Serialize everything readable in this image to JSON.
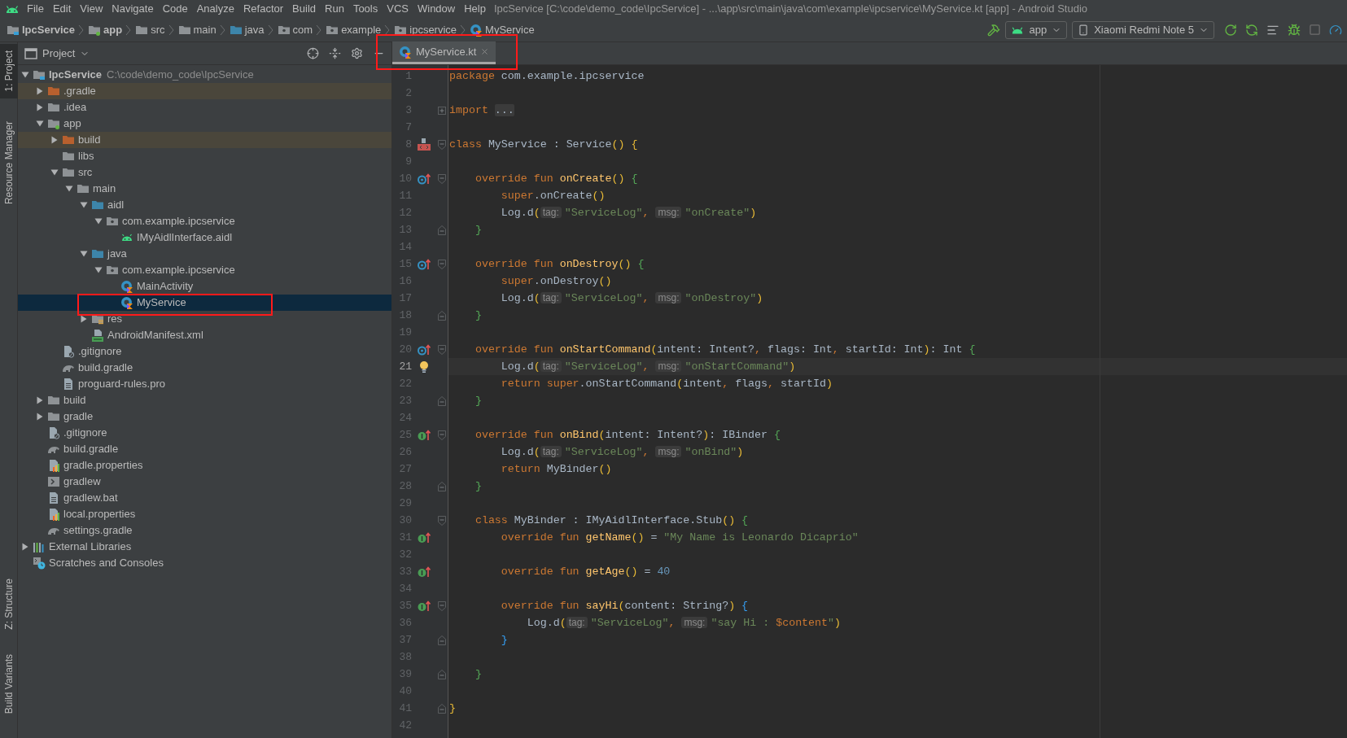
{
  "window": {
    "title": "IpcService [C:\\code\\demo_code\\IpcService] - ...\\app\\src\\main\\java\\com\\example\\ipcservice\\MyService.kt [app] - Android Studio"
  },
  "menu": [
    "File",
    "Edit",
    "View",
    "Navigate",
    "Code",
    "Analyze",
    "Refactor",
    "Build",
    "Run",
    "Tools",
    "VCS",
    "Window",
    "Help"
  ],
  "breadcrumbs": [
    {
      "label": "IpcService",
      "kind": "module"
    },
    {
      "label": "app",
      "kind": "module-app"
    },
    {
      "label": "src",
      "kind": "folder"
    },
    {
      "label": "main",
      "kind": "folder"
    },
    {
      "label": "java",
      "kind": "folder-source"
    },
    {
      "label": "com",
      "kind": "package"
    },
    {
      "label": "example",
      "kind": "package"
    },
    {
      "label": "ipcservice",
      "kind": "package"
    },
    {
      "label": "MyService",
      "kind": "kotlin-class"
    }
  ],
  "toolbar": {
    "run_config": "app",
    "device": "Xiaomi Redmi Note 5"
  },
  "tool_strip": {
    "top": [
      {
        "label": "1: Project",
        "selected": true
      },
      {
        "label": "Resource Manager",
        "selected": false
      }
    ],
    "bottom": [
      {
        "label": "Z: Structure",
        "selected": false
      },
      {
        "label": "Build Variants",
        "selected": false
      }
    ]
  },
  "project_panel": {
    "title": "Project",
    "tree": [
      {
        "label": "IpcService",
        "path": "C:\\code\\demo_code\\IpcService",
        "kind": "module",
        "expanded": true,
        "selected": false,
        "excluded": false,
        "children": [
          {
            "label": ".gradle",
            "kind": "folder-excluded",
            "expanded": false,
            "selected": false,
            "excluded": true
          },
          {
            "label": ".idea",
            "kind": "folder",
            "expanded": false,
            "selected": false,
            "excluded": false
          },
          {
            "label": "app",
            "kind": "module-app",
            "expanded": true,
            "selected": false,
            "excluded": false,
            "children": [
              {
                "label": "build",
                "kind": "folder-excluded",
                "expanded": false,
                "selected": false,
                "excluded": true
              },
              {
                "label": "libs",
                "kind": "folder",
                "selected": false,
                "excluded": false
              },
              {
                "label": "src",
                "kind": "folder",
                "expanded": true,
                "selected": false,
                "excluded": false,
                "children": [
                  {
                    "label": "main",
                    "kind": "folder",
                    "expanded": true,
                    "selected": false,
                    "excluded": false,
                    "children": [
                      {
                        "label": "aidl",
                        "kind": "folder-source",
                        "expanded": true,
                        "selected": false,
                        "excluded": false,
                        "children": [
                          {
                            "label": "com.example.ipcservice",
                            "kind": "package",
                            "expanded": true,
                            "selected": false,
                            "excluded": false,
                            "children": [
                              {
                                "label": "IMyAidlInterface.aidl",
                                "kind": "android",
                                "selected": false,
                                "excluded": false
                              }
                            ]
                          }
                        ]
                      },
                      {
                        "label": "java",
                        "kind": "folder-source",
                        "expanded": true,
                        "selected": false,
                        "excluded": false,
                        "children": [
                          {
                            "label": "com.example.ipcservice",
                            "kind": "package",
                            "expanded": true,
                            "selected": false,
                            "excluded": false,
                            "children": [
                              {
                                "label": "MainActivity",
                                "kind": "kotlin-class",
                                "selected": false,
                                "excluded": false
                              },
                              {
                                "label": "MyService",
                                "kind": "kotlin-class",
                                "selected": true,
                                "excluded": false
                              }
                            ]
                          }
                        ]
                      },
                      {
                        "label": "res",
                        "kind": "folder-res",
                        "expanded": false,
                        "selected": false,
                        "excluded": false
                      },
                      {
                        "label": "AndroidManifest.xml",
                        "kind": "manifest",
                        "selected": false,
                        "excluded": false
                      }
                    ]
                  }
                ]
              },
              {
                "label": ".gitignore",
                "kind": "ignore-file",
                "selected": false,
                "excluded": false
              },
              {
                "label": "build.gradle",
                "kind": "gradle",
                "selected": false,
                "excluded": false
              },
              {
                "label": "proguard-rules.pro",
                "kind": "text-file",
                "selected": false,
                "excluded": false
              }
            ]
          },
          {
            "label": "build",
            "kind": "folder",
            "expanded": false,
            "selected": false,
            "excluded": false
          },
          {
            "label": "gradle",
            "kind": "folder",
            "expanded": false,
            "selected": false,
            "excluded": false
          },
          {
            "label": ".gitignore",
            "kind": "ignore-file",
            "selected": false,
            "excluded": false
          },
          {
            "label": "build.gradle",
            "kind": "gradle",
            "selected": false,
            "excluded": false
          },
          {
            "label": "gradle.properties",
            "kind": "properties",
            "selected": false,
            "excluded": false
          },
          {
            "label": "gradlew",
            "kind": "script",
            "selected": false,
            "excluded": false
          },
          {
            "label": "gradlew.bat",
            "kind": "text-file",
            "selected": false,
            "excluded": false
          },
          {
            "label": "local.properties",
            "kind": "properties",
            "selected": false,
            "excluded": false
          },
          {
            "label": "settings.gradle",
            "kind": "gradle",
            "selected": false,
            "excluded": false
          }
        ]
      },
      {
        "label": "External Libraries",
        "kind": "libraries",
        "expanded": false,
        "selected": false,
        "excluded": false
      },
      {
        "label": "Scratches and Consoles",
        "kind": "scratches",
        "selected": false,
        "excluded": false
      }
    ]
  },
  "editor": {
    "tabs": [
      {
        "label": "MyService.kt",
        "selected": true
      }
    ],
    "lines": [
      {
        "number": "1",
        "current": false,
        "tokens": [
          {
            "kind": "kw",
            "text": "package"
          },
          {
            "kind": "text",
            "text": " com.example.ipcservice"
          }
        ]
      },
      {
        "number": "2",
        "current": false
      },
      {
        "number": "3",
        "current": false,
        "fold": {
          "kind": "collapsed"
        },
        "tokens": [
          {
            "kind": "kw",
            "text": "import "
          },
          {
            "kind": "folded",
            "text": "..."
          }
        ]
      },
      {
        "number": "7",
        "current": false
      },
      {
        "number": "8",
        "current": false,
        "gutter": {
          "kind": "class"
        },
        "fold": {
          "kind": "open"
        },
        "tokens": [
          {
            "kind": "kw",
            "text": "class"
          },
          {
            "kind": "text",
            "text": " MyService : Service"
          },
          {
            "kind": "brace1",
            "text": "() {"
          }
        ]
      },
      {
        "number": "9",
        "current": false
      },
      {
        "number": "10",
        "current": false,
        "gutter": {
          "kind": "override"
        },
        "fold": {
          "kind": "open"
        },
        "tokens": [
          {
            "kind": "kw",
            "text": "    override fun "
          },
          {
            "kind": "fn",
            "text": "onCreate"
          },
          {
            "kind": "brace1",
            "text": "()"
          },
          {
            "kind": "brace2",
            "text": " {"
          }
        ]
      },
      {
        "number": "11",
        "current": false,
        "tokens": [
          {
            "kind": "kw",
            "text": "        super"
          },
          {
            "kind": "text",
            "text": ".onCreate"
          },
          {
            "kind": "brace1",
            "text": "()"
          }
        ]
      },
      {
        "number": "12",
        "current": false,
        "tokens": [
          {
            "kind": "text",
            "text": "        Log.d"
          },
          {
            "kind": "brace1",
            "text": "("
          },
          {
            "kind": "hint",
            "text": "tag:"
          },
          {
            "kind": "str",
            "text": "\"ServiceLog\""
          },
          {
            "kind": "kw",
            "text": ", "
          },
          {
            "kind": "hint",
            "text": "msg:"
          },
          {
            "kind": "str",
            "text": "\"onCreate\""
          },
          {
            "kind": "brace1",
            "text": ")"
          }
        ]
      },
      {
        "number": "13",
        "current": false,
        "fold": {
          "kind": "close"
        },
        "tokens": [
          {
            "kind": "brace2",
            "text": "    }"
          }
        ]
      },
      {
        "number": "14",
        "current": false
      },
      {
        "number": "15",
        "current": false,
        "gutter": {
          "kind": "override"
        },
        "fold": {
          "kind": "open"
        },
        "tokens": [
          {
            "kind": "kw",
            "text": "    override fun "
          },
          {
            "kind": "fn",
            "text": "onDestroy"
          },
          {
            "kind": "brace1",
            "text": "()"
          },
          {
            "kind": "brace2",
            "text": " {"
          }
        ]
      },
      {
        "number": "16",
        "current": false,
        "tokens": [
          {
            "kind": "kw",
            "text": "        super"
          },
          {
            "kind": "text",
            "text": ".onDestroy"
          },
          {
            "kind": "brace1",
            "text": "()"
          }
        ]
      },
      {
        "number": "17",
        "current": false,
        "tokens": [
          {
            "kind": "text",
            "text": "        Log.d"
          },
          {
            "kind": "brace1",
            "text": "("
          },
          {
            "kind": "hint",
            "text": "tag:"
          },
          {
            "kind": "str",
            "text": "\"ServiceLog\""
          },
          {
            "kind": "kw",
            "text": ", "
          },
          {
            "kind": "hint",
            "text": "msg:"
          },
          {
            "kind": "str",
            "text": "\"onDestroy\""
          },
          {
            "kind": "brace1",
            "text": ")"
          }
        ]
      },
      {
        "number": "18",
        "current": false,
        "fold": {
          "kind": "close"
        },
        "tokens": [
          {
            "kind": "brace2",
            "text": "    }"
          }
        ]
      },
      {
        "number": "19",
        "current": false
      },
      {
        "number": "20",
        "current": false,
        "gutter": {
          "kind": "override"
        },
        "fold": {
          "kind": "open"
        },
        "tokens": [
          {
            "kind": "kw",
            "text": "    override fun "
          },
          {
            "kind": "fn",
            "text": "onStartCommand"
          },
          {
            "kind": "brace1",
            "text": "("
          },
          {
            "kind": "text",
            "text": "intent: Intent?"
          },
          {
            "kind": "kw",
            "text": ","
          },
          {
            "kind": "text",
            "text": " flags: Int"
          },
          {
            "kind": "kw",
            "text": ","
          },
          {
            "kind": "text",
            "text": " startId: Int"
          },
          {
            "kind": "brace1",
            "text": ")"
          },
          {
            "kind": "text",
            "text": ": Int"
          },
          {
            "kind": "brace2",
            "text": " {"
          }
        ]
      },
      {
        "number": "21",
        "current": true,
        "gutter": {
          "kind": "bulb"
        },
        "tokens": [
          {
            "kind": "text",
            "text": "        Log.d"
          },
          {
            "kind": "brace1",
            "text": "("
          },
          {
            "kind": "hint",
            "text": "tag:"
          },
          {
            "kind": "str",
            "text": "\"ServiceLog\""
          },
          {
            "kind": "kw",
            "text": ", "
          },
          {
            "kind": "hint",
            "text": "msg:"
          },
          {
            "kind": "str",
            "text": "\"onStartCommand\""
          },
          {
            "kind": "brace1",
            "text": ")"
          }
        ]
      },
      {
        "number": "22",
        "current": false,
        "tokens": [
          {
            "kind": "kw",
            "text": "        return super"
          },
          {
            "kind": "text",
            "text": ".onStartCommand"
          },
          {
            "kind": "brace1",
            "text": "("
          },
          {
            "kind": "text",
            "text": "intent"
          },
          {
            "kind": "kw",
            "text": ","
          },
          {
            "kind": "text",
            "text": " flags"
          },
          {
            "kind": "kw",
            "text": ","
          },
          {
            "kind": "text",
            "text": " startId"
          },
          {
            "kind": "brace1",
            "text": ")"
          }
        ]
      },
      {
        "number": "23",
        "current": false,
        "fold": {
          "kind": "close"
        },
        "tokens": [
          {
            "kind": "brace2",
            "text": "    }"
          }
        ]
      },
      {
        "number": "24",
        "current": false
      },
      {
        "number": "25",
        "current": false,
        "gutter": {
          "kind": "implement"
        },
        "fold": {
          "kind": "open"
        },
        "tokens": [
          {
            "kind": "kw",
            "text": "    override fun "
          },
          {
            "kind": "fn",
            "text": "onBind"
          },
          {
            "kind": "brace1",
            "text": "("
          },
          {
            "kind": "text",
            "text": "intent: Intent?"
          },
          {
            "kind": "brace1",
            "text": ")"
          },
          {
            "kind": "text",
            "text": ": IBinder"
          },
          {
            "kind": "brace2",
            "text": " {"
          }
        ]
      },
      {
        "number": "26",
        "current": false,
        "tokens": [
          {
            "kind": "text",
            "text": "        Log.d"
          },
          {
            "kind": "brace1",
            "text": "("
          },
          {
            "kind": "hint",
            "text": "tag:"
          },
          {
            "kind": "str",
            "text": "\"ServiceLog\""
          },
          {
            "kind": "kw",
            "text": ", "
          },
          {
            "kind": "hint",
            "text": "msg:"
          },
          {
            "kind": "str",
            "text": "\"onBind\""
          },
          {
            "kind": "brace1",
            "text": ")"
          }
        ]
      },
      {
        "number": "27",
        "current": false,
        "tokens": [
          {
            "kind": "kw",
            "text": "        return"
          },
          {
            "kind": "text",
            "text": " MyBinder"
          },
          {
            "kind": "brace1",
            "text": "()"
          }
        ]
      },
      {
        "number": "28",
        "current": false,
        "fold": {
          "kind": "close"
        },
        "tokens": [
          {
            "kind": "brace2",
            "text": "    }"
          }
        ]
      },
      {
        "number": "29",
        "current": false
      },
      {
        "number": "30",
        "current": false,
        "fold": {
          "kind": "open"
        },
        "tokens": [
          {
            "kind": "kw",
            "text": "    class"
          },
          {
            "kind": "text",
            "text": " MyBinder : IMyAidlInterface.Stub"
          },
          {
            "kind": "brace1",
            "text": "()"
          },
          {
            "kind": "brace2",
            "text": " {"
          }
        ]
      },
      {
        "number": "31",
        "current": false,
        "gutter": {
          "kind": "implement"
        },
        "tokens": [
          {
            "kind": "kw",
            "text": "        override fun "
          },
          {
            "kind": "fn",
            "text": "getName"
          },
          {
            "kind": "brace1",
            "text": "()"
          },
          {
            "kind": "text",
            "text": " = "
          },
          {
            "kind": "str",
            "text": "\"My Name is Leonardo Dicaprio\""
          }
        ]
      },
      {
        "number": "32",
        "current": false
      },
      {
        "number": "33",
        "current": false,
        "gutter": {
          "kind": "implement"
        },
        "tokens": [
          {
            "kind": "kw",
            "text": "        override fun "
          },
          {
            "kind": "fn",
            "text": "getAge"
          },
          {
            "kind": "brace1",
            "text": "()"
          },
          {
            "kind": "text",
            "text": " = "
          },
          {
            "kind": "num",
            "text": "40"
          }
        ]
      },
      {
        "number": "34",
        "current": false
      },
      {
        "number": "35",
        "current": false,
        "gutter": {
          "kind": "implement"
        },
        "fold": {
          "kind": "open"
        },
        "tokens": [
          {
            "kind": "kw",
            "text": "        override fun "
          },
          {
            "kind": "fn",
            "text": "sayHi"
          },
          {
            "kind": "brace1",
            "text": "("
          },
          {
            "kind": "text",
            "text": "content: String?"
          },
          {
            "kind": "brace1",
            "text": ")"
          },
          {
            "kind": "brace3",
            "text": " {"
          }
        ]
      },
      {
        "number": "36",
        "current": false,
        "tokens": [
          {
            "kind": "text",
            "text": "            Log.d"
          },
          {
            "kind": "brace1",
            "text": "("
          },
          {
            "kind": "hint",
            "text": "tag:"
          },
          {
            "kind": "str",
            "text": "\"ServiceLog\""
          },
          {
            "kind": "kw",
            "text": ", "
          },
          {
            "kind": "hint",
            "text": "msg:"
          },
          {
            "kind": "str",
            "text": "\"say Hi : "
          },
          {
            "kind": "interp",
            "text": "$content"
          },
          {
            "kind": "str",
            "text": "\""
          },
          {
            "kind": "brace1",
            "text": ")"
          }
        ]
      },
      {
        "number": "37",
        "current": false,
        "fold": {
          "kind": "close"
        },
        "tokens": [
          {
            "kind": "brace3",
            "text": "        }"
          }
        ]
      },
      {
        "number": "38",
        "current": false
      },
      {
        "number": "39",
        "current": false,
        "fold": {
          "kind": "close"
        },
        "tokens": [
          {
            "kind": "brace2",
            "text": "    }"
          }
        ]
      },
      {
        "number": "40",
        "current": false
      },
      {
        "number": "41",
        "current": false,
        "fold": {
          "kind": "close"
        },
        "tokens": [
          {
            "kind": "brace1",
            "text": "}"
          }
        ]
      },
      {
        "number": "42",
        "current": false
      }
    ]
  }
}
